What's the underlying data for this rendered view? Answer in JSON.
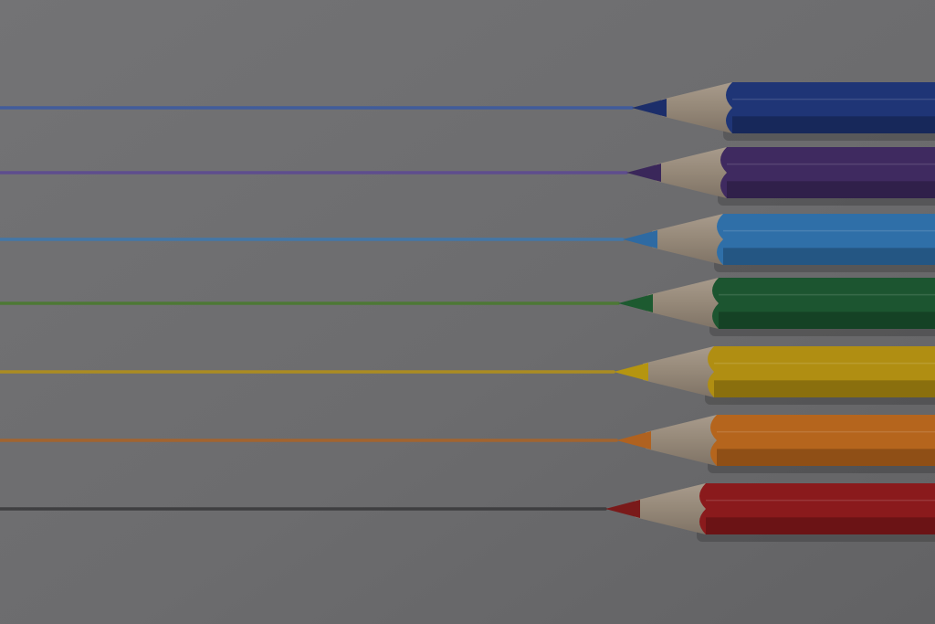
{
  "scene": {
    "paper_color": "#6e6e70",
    "pencils": [
      {
        "color_name": "dark-blue",
        "body": "#1f3576",
        "body_dark": "#17285a",
        "lead": "#1c2e6a",
        "line": "#3d5aa0"
      },
      {
        "color_name": "purple",
        "body": "#3f2a60",
        "body_dark": "#30204a",
        "lead": "#3a275a",
        "line": "#5d4a92"
      },
      {
        "color_name": "light-blue",
        "body": "#2f6fa8",
        "body_dark": "#245683",
        "lead": "#2e6aa2",
        "line": "#3f78ad"
      },
      {
        "color_name": "green",
        "body": "#1c5530",
        "body_dark": "#154225",
        "lead": "#1d5a30",
        "line": "#4a7a2f"
      },
      {
        "color_name": "yellow",
        "body": "#b08e12",
        "body_dark": "#8a6f0e",
        "lead": "#b59510",
        "line": "#b2901a"
      },
      {
        "color_name": "orange",
        "body": "#b5651d",
        "body_dark": "#8f4f16",
        "lead": "#b06220",
        "line": "#a8642a"
      },
      {
        "color_name": "red",
        "body": "#8a1a1c",
        "body_dark": "#6b1315",
        "lead": "#7a1a1a",
        "line": "#3a3a3c"
      }
    ]
  }
}
